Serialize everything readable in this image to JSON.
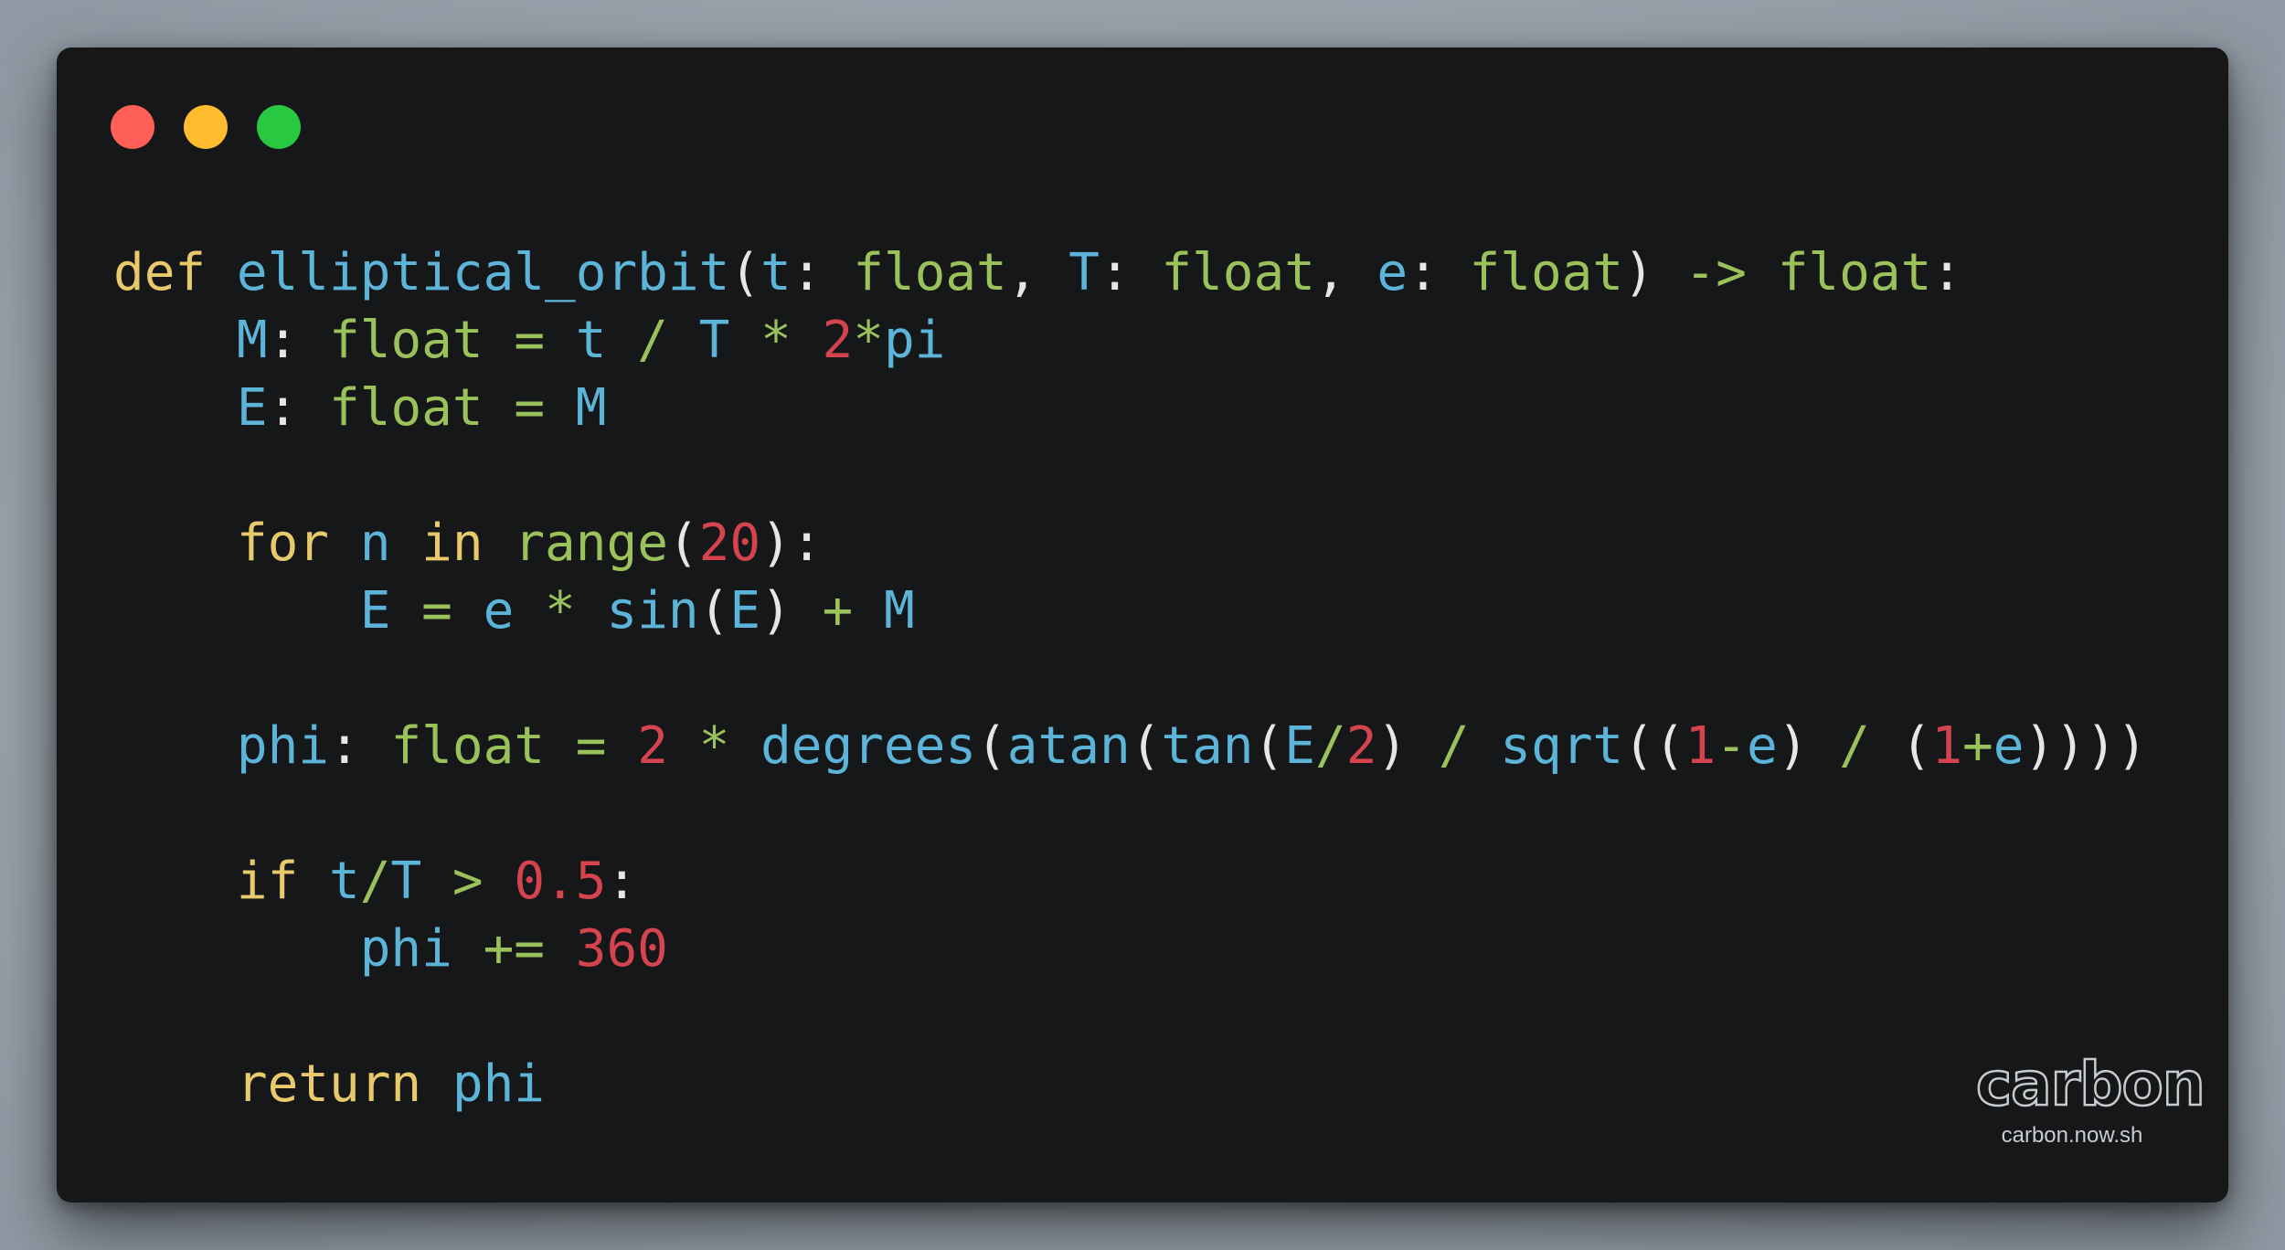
{
  "colors": {
    "background": "#9ba5ae",
    "window": "#151719",
    "keyword": "#e8c96b",
    "identifier": "#5cb4d8",
    "type": "#9bc25a",
    "number": "#d5434f",
    "punctuation": "#e4e6e8"
  },
  "window_controls": [
    {
      "name": "close",
      "color": "#fe5f57"
    },
    {
      "name": "minimize",
      "color": "#febc2e"
    },
    {
      "name": "maximize",
      "color": "#28c840"
    }
  ],
  "code": {
    "language": "python",
    "lines": [
      [
        {
          "t": "def",
          "c": "kw"
        },
        {
          "t": " "
        },
        {
          "t": "elliptical_orbit",
          "c": "fn"
        },
        {
          "t": "(",
          "c": "pn"
        },
        {
          "t": "t",
          "c": "var"
        },
        {
          "t": ": ",
          "c": "pn"
        },
        {
          "t": "float",
          "c": "type"
        },
        {
          "t": ", ",
          "c": "pn"
        },
        {
          "t": "T",
          "c": "var"
        },
        {
          "t": ": ",
          "c": "pn"
        },
        {
          "t": "float",
          "c": "type"
        },
        {
          "t": ", ",
          "c": "pn"
        },
        {
          "t": "e",
          "c": "var"
        },
        {
          "t": ": ",
          "c": "pn"
        },
        {
          "t": "float",
          "c": "type"
        },
        {
          "t": ") ",
          "c": "pn"
        },
        {
          "t": "->",
          "c": "op"
        },
        {
          "t": " "
        },
        {
          "t": "float",
          "c": "type"
        },
        {
          "t": ":",
          "c": "pn"
        }
      ],
      [
        {
          "t": "    "
        },
        {
          "t": "M",
          "c": "var"
        },
        {
          "t": ": ",
          "c": "pn"
        },
        {
          "t": "float",
          "c": "type"
        },
        {
          "t": " "
        },
        {
          "t": "=",
          "c": "op"
        },
        {
          "t": " "
        },
        {
          "t": "t",
          "c": "var"
        },
        {
          "t": " "
        },
        {
          "t": "/",
          "c": "op"
        },
        {
          "t": " "
        },
        {
          "t": "T",
          "c": "var"
        },
        {
          "t": " "
        },
        {
          "t": "*",
          "c": "op"
        },
        {
          "t": " "
        },
        {
          "t": "2",
          "c": "num"
        },
        {
          "t": "*",
          "c": "op"
        },
        {
          "t": "pi",
          "c": "var"
        }
      ],
      [
        {
          "t": "    "
        },
        {
          "t": "E",
          "c": "var"
        },
        {
          "t": ": ",
          "c": "pn"
        },
        {
          "t": "float",
          "c": "type"
        },
        {
          "t": " "
        },
        {
          "t": "=",
          "c": "op"
        },
        {
          "t": " "
        },
        {
          "t": "M",
          "c": "var"
        }
      ],
      [],
      [
        {
          "t": "    "
        },
        {
          "t": "for",
          "c": "kw"
        },
        {
          "t": " "
        },
        {
          "t": "n",
          "c": "var"
        },
        {
          "t": " "
        },
        {
          "t": "in",
          "c": "kw"
        },
        {
          "t": " "
        },
        {
          "t": "range",
          "c": "type"
        },
        {
          "t": "(",
          "c": "pn"
        },
        {
          "t": "20",
          "c": "num"
        },
        {
          "t": "):",
          "c": "pn"
        }
      ],
      [
        {
          "t": "        "
        },
        {
          "t": "E",
          "c": "var"
        },
        {
          "t": " "
        },
        {
          "t": "=",
          "c": "op"
        },
        {
          "t": " "
        },
        {
          "t": "e",
          "c": "var"
        },
        {
          "t": " "
        },
        {
          "t": "*",
          "c": "op"
        },
        {
          "t": " "
        },
        {
          "t": "sin",
          "c": "fn"
        },
        {
          "t": "(",
          "c": "pn"
        },
        {
          "t": "E",
          "c": "var"
        },
        {
          "t": ")",
          "c": "pn"
        },
        {
          "t": " "
        },
        {
          "t": "+",
          "c": "op"
        },
        {
          "t": " "
        },
        {
          "t": "M",
          "c": "var"
        }
      ],
      [],
      [
        {
          "t": "    "
        },
        {
          "t": "phi",
          "c": "var"
        },
        {
          "t": ": ",
          "c": "pn"
        },
        {
          "t": "float",
          "c": "type"
        },
        {
          "t": " "
        },
        {
          "t": "=",
          "c": "op"
        },
        {
          "t": " "
        },
        {
          "t": "2",
          "c": "num"
        },
        {
          "t": " "
        },
        {
          "t": "*",
          "c": "op"
        },
        {
          "t": " "
        },
        {
          "t": "degrees",
          "c": "fn"
        },
        {
          "t": "(",
          "c": "pn"
        },
        {
          "t": "atan",
          "c": "fn"
        },
        {
          "t": "(",
          "c": "pn"
        },
        {
          "t": "tan",
          "c": "fn"
        },
        {
          "t": "(",
          "c": "pn"
        },
        {
          "t": "E",
          "c": "var"
        },
        {
          "t": "/",
          "c": "op"
        },
        {
          "t": "2",
          "c": "num"
        },
        {
          "t": ")",
          "c": "pn"
        },
        {
          "t": " "
        },
        {
          "t": "/",
          "c": "op"
        },
        {
          "t": " "
        },
        {
          "t": "sqrt",
          "c": "fn"
        },
        {
          "t": "((",
          "c": "pn"
        },
        {
          "t": "1",
          "c": "num"
        },
        {
          "t": "-",
          "c": "op"
        },
        {
          "t": "e",
          "c": "var"
        },
        {
          "t": ")",
          "c": "pn"
        },
        {
          "t": " "
        },
        {
          "t": "/",
          "c": "op"
        },
        {
          "t": " "
        },
        {
          "t": "(",
          "c": "pn"
        },
        {
          "t": "1",
          "c": "num"
        },
        {
          "t": "+",
          "c": "op"
        },
        {
          "t": "e",
          "c": "var"
        },
        {
          "t": "))))",
          "c": "pn"
        }
      ],
      [],
      [
        {
          "t": "    "
        },
        {
          "t": "if",
          "c": "kw"
        },
        {
          "t": " "
        },
        {
          "t": "t",
          "c": "var"
        },
        {
          "t": "/",
          "c": "op"
        },
        {
          "t": "T",
          "c": "var"
        },
        {
          "t": " "
        },
        {
          "t": ">",
          "c": "op"
        },
        {
          "t": " "
        },
        {
          "t": "0.5",
          "c": "num"
        },
        {
          "t": ":",
          "c": "pn"
        }
      ],
      [
        {
          "t": "        "
        },
        {
          "t": "phi",
          "c": "var"
        },
        {
          "t": " "
        },
        {
          "t": "+=",
          "c": "op"
        },
        {
          "t": " "
        },
        {
          "t": "360",
          "c": "num"
        }
      ],
      [],
      [
        {
          "t": "    "
        },
        {
          "t": "return",
          "c": "kw"
        },
        {
          "t": " "
        },
        {
          "t": "phi",
          "c": "var"
        }
      ]
    ]
  },
  "branding": {
    "logo_text": "carbon",
    "url": "carbon.now.sh"
  }
}
